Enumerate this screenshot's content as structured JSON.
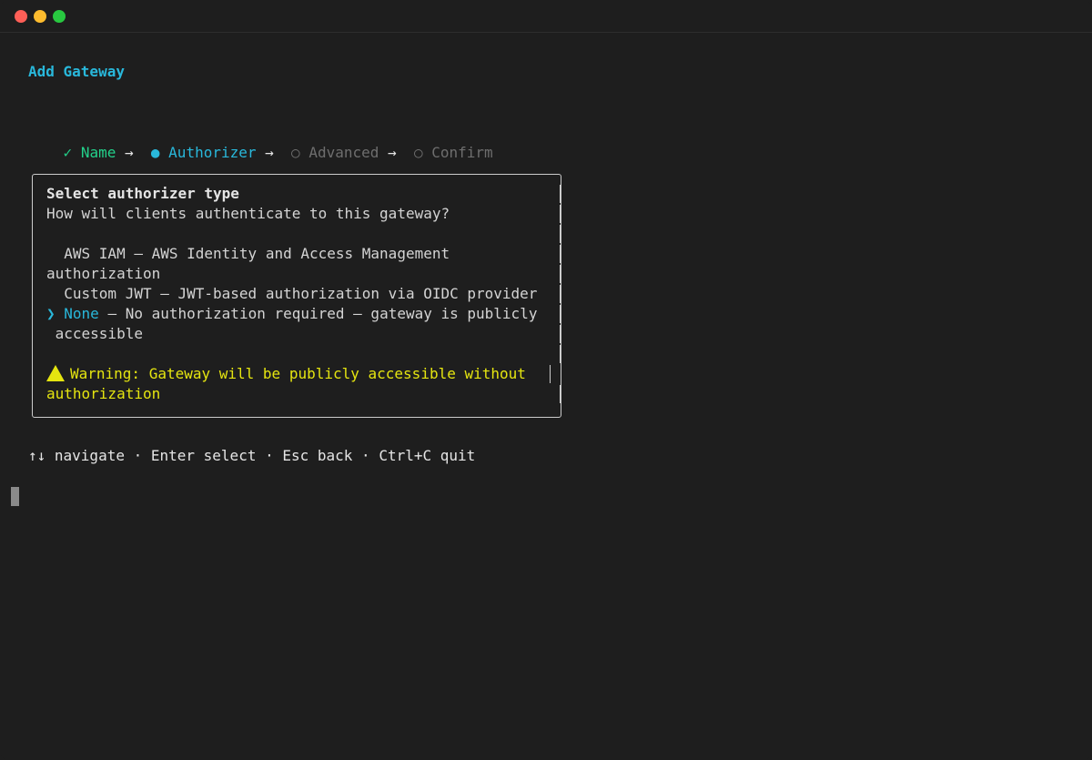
{
  "header": {
    "title": "Add Gateway"
  },
  "steps": [
    {
      "mark": "✓",
      "label": "Name",
      "state": "done"
    },
    {
      "mark": "●",
      "label": "Authorizer",
      "state": "active"
    },
    {
      "mark": "○",
      "label": "Advanced",
      "state": "pending"
    },
    {
      "mark": "○",
      "label": "Confirm",
      "state": "pending"
    }
  ],
  "step_separator": "→",
  "prompt": {
    "heading": "Select authorizer type",
    "question": "How will clients authenticate to this gateway?",
    "selector": "❯",
    "options": [
      {
        "line1": "  AWS IAM — AWS Identity and Access Management",
        "line2": "authorization"
      },
      {
        "line1": "  Custom JWT — JWT-based authorization via OIDC provider"
      },
      {
        "name": "None",
        "desc": " — No authorization required — gateway is publicly",
        "line2": " accessible",
        "selected": true
      }
    ],
    "warning": {
      "line1": "Warning: Gateway will be publicly accessible without",
      "line2": "authorization"
    }
  },
  "footer": {
    "help": "↑↓ navigate · Enter select · Esc back · Ctrl+C quit"
  },
  "colors": {
    "accent": "#29b8db",
    "success": "#23d18b",
    "warning": "#e5e510",
    "muted": "#6e6e6e"
  }
}
